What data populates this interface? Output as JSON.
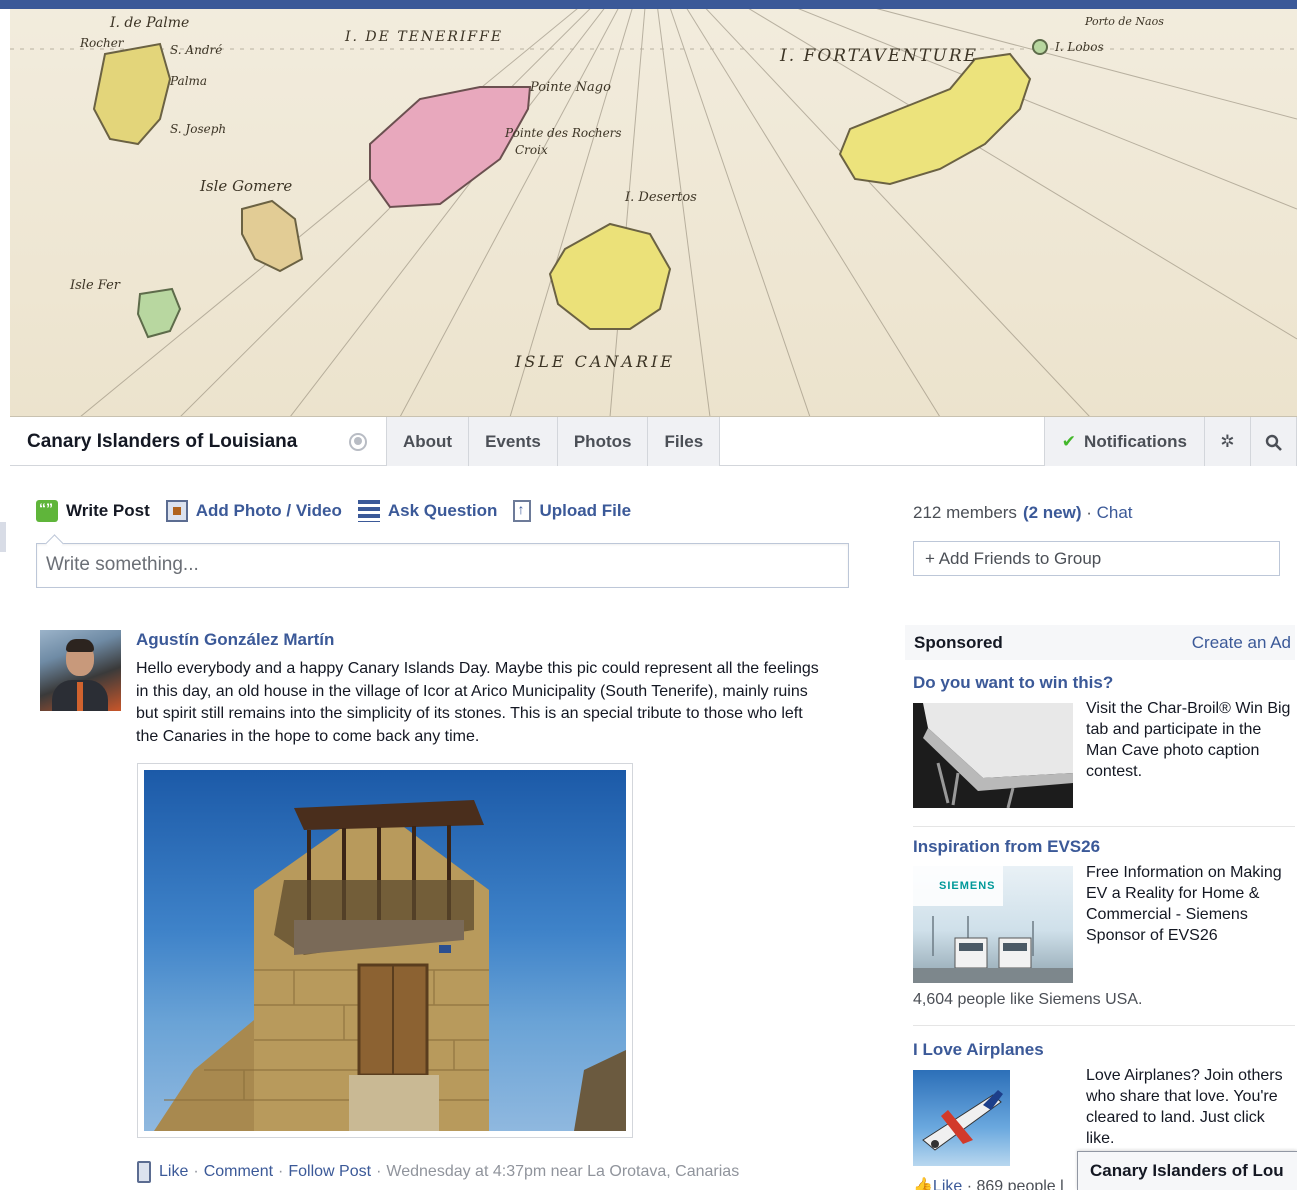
{
  "cover": {
    "map_labels": [
      "I. de Palme",
      "Rocher",
      "S. André",
      "Palma",
      "I. DE TENERIFFE",
      "Pointe Nago",
      "I. FORTAVENTURE",
      "I. Lobos",
      "Porto de Naos",
      "Isle Gomere",
      "Isle Fer",
      "I. Desertos",
      "ISLE CANARIE",
      "Pointe des Rochers",
      "Croix",
      "S. Joseph"
    ]
  },
  "group": {
    "title": "Canary Islanders of Louisiana",
    "tabs": [
      "About",
      "Events",
      "Photos",
      "Files"
    ],
    "notifications_label": "Notifications"
  },
  "composer": {
    "write_post": "Write Post",
    "add_photo": "Add Photo / Video",
    "ask_question": "Ask Question",
    "upload_file": "Upload File",
    "placeholder": "Write something..."
  },
  "post": {
    "author": "Agustín González Martín",
    "text": "Hello everybody and a happy Canary Islands Day. Maybe this pic could represent all the feelings in this day, an old house in the village of Icor at Arico Municipality (South Tenerife), mainly ruins but spirit still remains into the simplicity of its stones. This is an special tribute to those who left the Canaries in the hope to come back any time.",
    "footer": {
      "like": "Like",
      "comment": "Comment",
      "follow": "Follow Post",
      "timestamp": "Wednesday at 4:37pm near La Orotava, Canarias"
    }
  },
  "sidebar": {
    "members": "212 members",
    "new": "(2 new)",
    "chat": "Chat",
    "add_friends": "+ Add Friends to Group",
    "sponsored": "Sponsored",
    "create_ad": "Create an Ad",
    "ads": [
      {
        "title": "Do you want to win this?",
        "text": "Visit the Char-Broil® Win Big tab and participate in the Man Cave photo caption contest."
      },
      {
        "title": "Inspiration from EVS26",
        "text": "Free Information on Making EV a Reality for Home & Commercial - Siemens Sponsor of EVS26",
        "likes": "4,604 people like Siemens USA.",
        "brand": "SIEMENS"
      },
      {
        "title": "I Love Airplanes",
        "text": "Love Airplanes? Join others who share that love. You're cleared to land. Just click like.",
        "like_label": "Like",
        "likes": "869 people l"
      }
    ]
  },
  "chat_bar": {
    "label": "Canary Islanders of Lou"
  }
}
